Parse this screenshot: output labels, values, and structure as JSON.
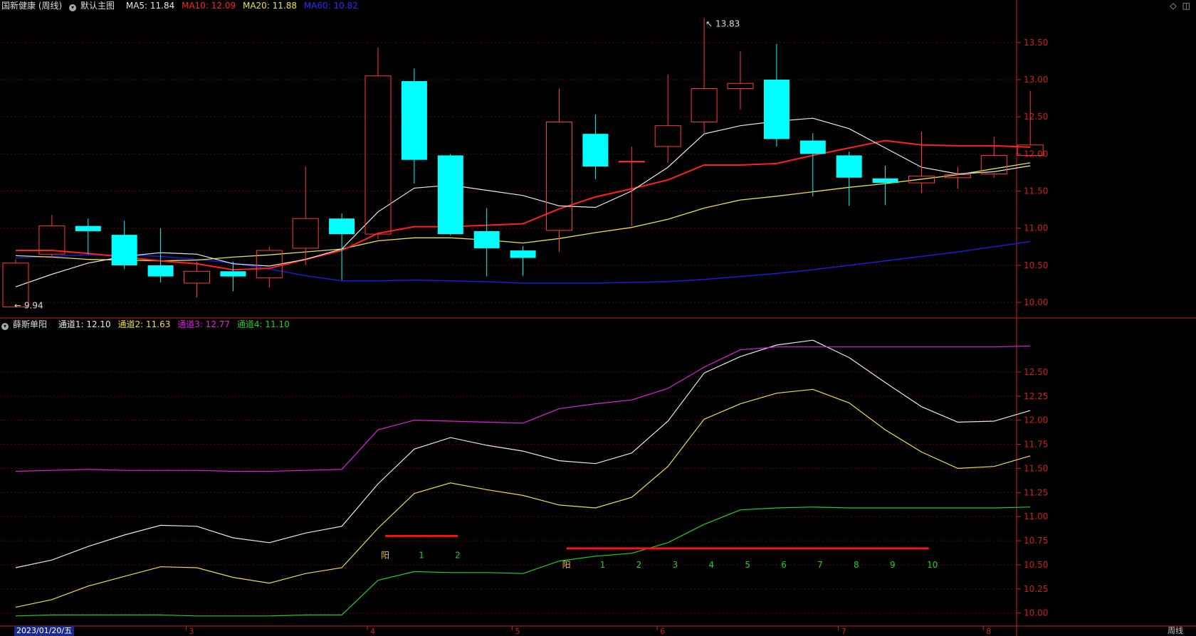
{
  "header": {
    "stock_name": "国新健康 (周线)",
    "main_chart_label": "默认主图",
    "ma5": "MA5: 11.84",
    "ma10": "MA10: 12.09",
    "ma20": "MA20: 11.88",
    "ma60": "MA60: 10.82"
  },
  "sub_header": {
    "indicator_name": "薛斯单阳",
    "ch1": "通道1: 12.10",
    "ch2": "通道2: 11.63",
    "ch3": "通道3: 12.77",
    "ch4": "通道4: 11.10"
  },
  "toolbar": {
    "diamond_icon": "diamond-icon",
    "restore_icon": "window-restore-icon"
  },
  "footer": {
    "date": "2023/01/20/五",
    "period": "周线"
  },
  "colors": {
    "up": "#ff3b3b",
    "down": "#00ffff",
    "ma5": "#e8e8e8",
    "ma10": "#ff2020",
    "ma20": "#e8e04a",
    "ma60": "#1a1adc",
    "ch1": "#e8e8e8",
    "ch2": "#e8e04a",
    "ch3": "#e020e0",
    "ch4": "#20d020",
    "grid": "#6a0000",
    "axis": "#cc2020"
  },
  "chart_data": [
    {
      "type": "candlestick",
      "ylim": [
        9.8,
        13.9
      ],
      "y_ticks": [
        10.0,
        10.5,
        11.0,
        11.5,
        12.0,
        12.5,
        13.0,
        13.5
      ],
      "x_ticks": [
        "3",
        "4",
        "5",
        "6",
        "7",
        "8"
      ],
      "annotations": [
        {
          "text": "13.83"
        },
        {
          "text": "9.94"
        }
      ],
      "candles": [
        {
          "o": 9.94,
          "c": 10.53,
          "h": 10.58,
          "l": 9.94
        },
        {
          "o": 10.65,
          "c": 11.03,
          "h": 11.18,
          "l": 10.6
        },
        {
          "o": 11.03,
          "c": 10.96,
          "h": 11.13,
          "l": 10.65
        },
        {
          "o": 10.91,
          "c": 10.5,
          "h": 11.1,
          "l": 10.45
        },
        {
          "o": 10.5,
          "c": 10.35,
          "h": 11.0,
          "l": 10.27
        },
        {
          "o": 10.26,
          "c": 10.42,
          "h": 10.55,
          "l": 10.07
        },
        {
          "o": 10.42,
          "c": 10.35,
          "h": 10.55,
          "l": 10.15
        },
        {
          "o": 10.33,
          "c": 10.7,
          "h": 10.75,
          "l": 10.2
        },
        {
          "o": 10.73,
          "c": 11.13,
          "h": 11.83,
          "l": 10.5
        },
        {
          "o": 11.13,
          "c": 10.92,
          "h": 11.2,
          "l": 10.3
        },
        {
          "o": 10.92,
          "c": 13.05,
          "h": 13.43,
          "l": 10.85
        },
        {
          "o": 12.98,
          "c": 11.92,
          "h": 13.15,
          "l": 11.6
        },
        {
          "o": 11.98,
          "c": 10.92,
          "h": 12.0,
          "l": 10.9
        },
        {
          "o": 10.96,
          "c": 10.73,
          "h": 11.27,
          "l": 10.35
        },
        {
          "o": 10.7,
          "c": 10.6,
          "h": 10.76,
          "l": 10.36
        },
        {
          "o": 10.97,
          "c": 12.43,
          "h": 12.88,
          "l": 10.68
        },
        {
          "o": 12.27,
          "c": 11.83,
          "h": 12.53,
          "l": 11.66
        },
        {
          "o": 11.9,
          "c": 11.9,
          "h": 12.1,
          "l": 11.03
        },
        {
          "o": 12.1,
          "c": 12.38,
          "h": 13.07,
          "l": 11.88
        },
        {
          "o": 12.43,
          "c": 12.88,
          "h": 13.83,
          "l": 12.28
        },
        {
          "o": 12.88,
          "c": 12.95,
          "h": 13.38,
          "l": 12.6
        },
        {
          "o": 13.0,
          "c": 12.2,
          "h": 13.48,
          "l": 12.1
        },
        {
          "o": 12.18,
          "c": 12.0,
          "h": 12.28,
          "l": 11.43
        },
        {
          "o": 11.98,
          "c": 11.68,
          "h": 12.03,
          "l": 11.3
        },
        {
          "o": 11.67,
          "c": 11.61,
          "h": 11.84,
          "l": 11.31
        },
        {
          "o": 11.61,
          "c": 11.7,
          "h": 12.3,
          "l": 11.47
        },
        {
          "o": 11.68,
          "c": 11.72,
          "h": 11.83,
          "l": 11.53
        },
        {
          "o": 11.73,
          "c": 11.98,
          "h": 12.23,
          "l": 11.68
        },
        {
          "o": 11.98,
          "c": 12.12,
          "h": 12.85,
          "l": 11.98
        }
      ],
      "ma5": [
        10.21,
        10.38,
        10.53,
        10.62,
        10.67,
        10.65,
        10.52,
        10.49,
        10.58,
        10.72,
        11.22,
        11.54,
        11.58,
        11.51,
        11.44,
        11.3,
        11.28,
        11.5,
        11.82,
        12.27,
        12.38,
        12.44,
        12.48,
        12.34,
        12.08,
        11.82,
        11.73,
        11.76,
        11.84
      ],
      "ma10": [
        10.7,
        10.7,
        10.66,
        10.61,
        10.56,
        10.52,
        10.44,
        10.46,
        10.58,
        10.7,
        10.93,
        11.02,
        11.02,
        11.04,
        11.06,
        11.26,
        11.42,
        11.53,
        11.65,
        11.85,
        11.85,
        11.87,
        11.98,
        12.08,
        12.18,
        12.12,
        12.11,
        12.11,
        12.09
      ],
      "ma20": [
        10.63,
        10.61,
        10.58,
        10.57,
        10.56,
        10.57,
        10.61,
        10.64,
        10.68,
        10.72,
        10.83,
        10.87,
        10.87,
        10.84,
        10.8,
        10.86,
        10.94,
        11.01,
        11.12,
        11.27,
        11.38,
        11.43,
        11.49,
        11.55,
        11.6,
        11.66,
        11.72,
        11.8,
        11.88
      ],
      "ma60": [
        10.6,
        10.62,
        10.64,
        10.64,
        10.62,
        10.58,
        10.53,
        10.45,
        10.36,
        10.29,
        10.29,
        10.3,
        10.29,
        10.28,
        10.26,
        10.26,
        10.26,
        10.27,
        10.28,
        10.31,
        10.35,
        10.39,
        10.44,
        10.5,
        10.56,
        10.62,
        10.68,
        10.75,
        10.82
      ]
    },
    {
      "type": "line",
      "ylim": [
        9.88,
        12.92
      ],
      "y_ticks": [
        10.0,
        10.25,
        10.5,
        10.75,
        11.0,
        11.25,
        11.5,
        11.75,
        12.0,
        12.25,
        12.5
      ],
      "series": [
        {
          "name": "通道1",
          "values": [
            10.47,
            10.55,
            10.69,
            10.81,
            10.91,
            10.9,
            10.78,
            10.73,
            10.83,
            10.9,
            11.34,
            11.7,
            11.82,
            11.74,
            11.68,
            11.58,
            11.55,
            11.66,
            11.99,
            12.49,
            12.66,
            12.78,
            12.83,
            12.65,
            12.39,
            12.14,
            11.98,
            11.99,
            12.1
          ]
        },
        {
          "name": "通道2",
          "values": [
            10.06,
            10.14,
            10.28,
            10.38,
            10.48,
            10.47,
            10.37,
            10.31,
            10.41,
            10.47,
            10.88,
            11.24,
            11.35,
            11.28,
            11.22,
            11.12,
            11.09,
            11.2,
            11.52,
            12.01,
            12.17,
            12.28,
            12.32,
            12.18,
            11.9,
            11.67,
            11.5,
            11.52,
            11.63
          ]
        },
        {
          "name": "通道3",
          "values": [
            11.47,
            11.48,
            11.49,
            11.48,
            11.48,
            11.48,
            11.47,
            11.47,
            11.48,
            11.49,
            11.9,
            12.0,
            11.99,
            11.98,
            11.97,
            12.12,
            12.17,
            12.21,
            12.33,
            12.55,
            12.73,
            12.76,
            12.76,
            12.76,
            12.76,
            12.76,
            12.76,
            12.76,
            12.77
          ]
        },
        {
          "name": "通道4",
          "values": [
            9.97,
            9.98,
            9.98,
            9.98,
            9.98,
            9.97,
            9.97,
            9.97,
            9.98,
            9.98,
            10.34,
            10.43,
            10.42,
            10.42,
            10.41,
            10.54,
            10.59,
            10.62,
            10.73,
            10.92,
            11.07,
            11.09,
            11.1,
            11.09,
            11.09,
            11.09,
            11.09,
            11.09,
            11.1
          ]
        }
      ],
      "signals": [
        {
          "line_from": 10.2,
          "line_to": 12.2,
          "level": 10.8,
          "text_level": 10.57,
          "labels": [
            "阳",
            "1",
            "2"
          ],
          "label_idx": [
            10.2,
            11.2,
            12.2
          ]
        },
        {
          "line_from": 15.2,
          "line_to": 25.2,
          "level": 10.67,
          "text_level": 10.47,
          "labels": [
            "阳",
            "1",
            "2",
            "3",
            "4",
            "5",
            "6",
            "7",
            "8",
            "9",
            "10"
          ],
          "label_idx": [
            15.2,
            16.2,
            17.2,
            18.2,
            19.2,
            20.2,
            21.2,
            22.2,
            23.2,
            24.2,
            25.3
          ]
        }
      ]
    }
  ]
}
